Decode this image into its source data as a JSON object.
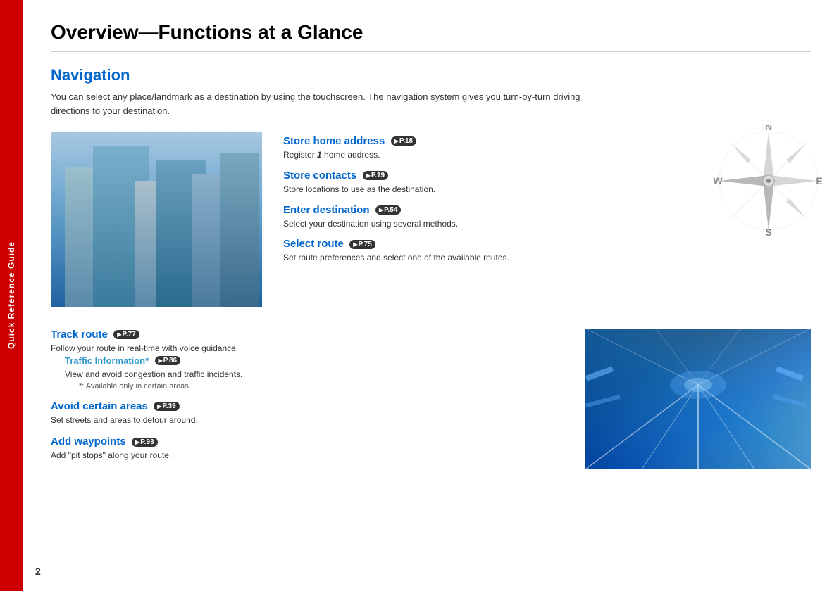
{
  "sidebar": {
    "label": "Quick Reference Guide"
  },
  "page": {
    "title": "Overview—Functions at a Glance",
    "number": "2"
  },
  "navigation": {
    "section_title": "Navigation",
    "description": "You can select any place/landmark as a destination by using the touchscreen. The navigation system gives you turn-by-turn driving directions to your destination.",
    "features": [
      {
        "id": "store-home",
        "title": "Store home address",
        "page_ref": "P.18",
        "description_parts": [
          "Register ",
          "1",
          " home address."
        ],
        "has_italic": true
      },
      {
        "id": "store-contacts",
        "title": "Store contacts",
        "page_ref": "P.19",
        "description": "Store locations to use as the destination."
      },
      {
        "id": "enter-destination",
        "title": "Enter destination",
        "page_ref": "P.54",
        "description": "Select your destination using several methods."
      },
      {
        "id": "select-route",
        "title": "Select route",
        "page_ref": "P.75",
        "description": "Set route preferences and select one of the available routes."
      }
    ],
    "bottom_features": [
      {
        "id": "track-route",
        "title": "Track route",
        "page_ref": "P.77",
        "description": "Follow your route in real-time with voice guidance.",
        "sub_features": [
          {
            "id": "traffic-info",
            "title": "Traffic Information*",
            "page_ref": "P.86",
            "description": "View and avoid congestion and traffic incidents.",
            "note": "*: Available only in certain areas."
          }
        ]
      },
      {
        "id": "avoid-areas",
        "title": "Avoid certain areas",
        "page_ref": "P.39",
        "description": "Set streets and areas to detour around."
      },
      {
        "id": "add-waypoints",
        "title": "Add waypoints",
        "page_ref": "P.93",
        "description": "Add “pit stops” along your route."
      }
    ]
  },
  "compass": {
    "directions": [
      "N",
      "E",
      "S",
      "W"
    ]
  }
}
